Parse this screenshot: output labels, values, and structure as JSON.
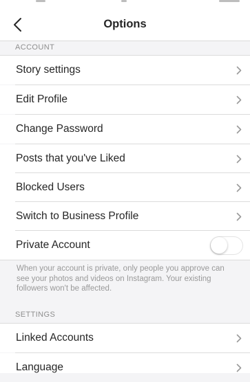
{
  "header": {
    "title": "Options"
  },
  "account_section": {
    "title": "ACCOUNT",
    "items": [
      {
        "label": "Story settings"
      },
      {
        "label": "Edit Profile"
      },
      {
        "label": "Change Password"
      },
      {
        "label": "Posts that you've Liked"
      },
      {
        "label": "Blocked Users"
      },
      {
        "label": "Switch to Business Profile"
      }
    ],
    "private_account": {
      "label": "Private Account",
      "enabled": false,
      "note": "When your account is private, only people you approve can see your photos and videos on Instagram. Your existing followers won't be affected."
    }
  },
  "settings_section": {
    "title": "SETTINGS",
    "items": [
      {
        "label": "Linked Accounts"
      },
      {
        "label": "Language"
      }
    ]
  },
  "icons": {
    "back": "chevron-left-icon",
    "row_arrow": "chevron-right-icon"
  },
  "colors": {
    "text": "#262626",
    "secondary": "#8e8e8e",
    "separator": "#dbdbdb",
    "background": "#f4f4f6"
  }
}
